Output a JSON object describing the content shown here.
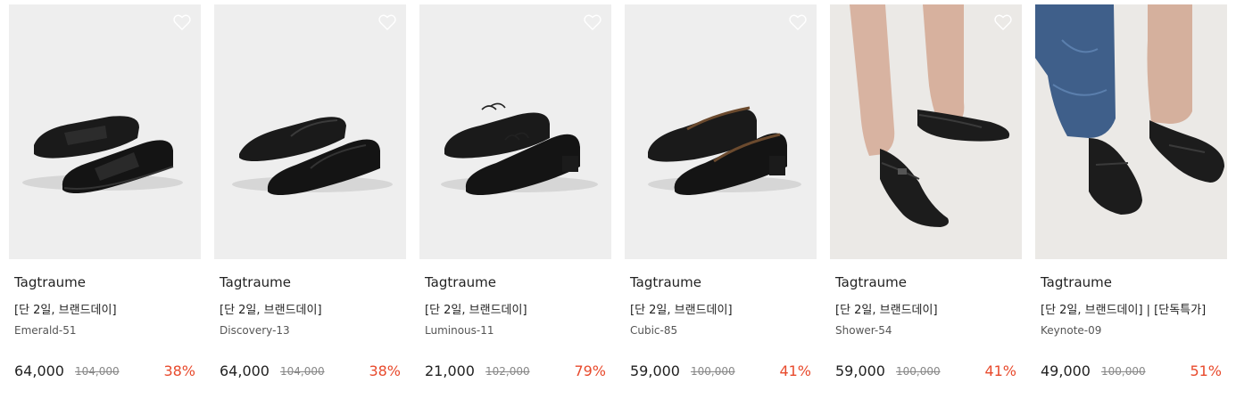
{
  "accent_color": "#e84a2c",
  "products": [
    {
      "brand": "Tagtraume",
      "promo": "[단 2일, 브랜드데이]",
      "model": "Emerald-51",
      "price": "64,000",
      "original_price": "104,000",
      "discount": "38%",
      "image": "black-penny-loafers",
      "heart_icon": "heart-outline-icon"
    },
    {
      "brand": "Tagtraume",
      "promo": "[단 2일, 브랜드데이]",
      "model": "Discovery-13",
      "price": "64,000",
      "original_price": "104,000",
      "discount": "38%",
      "image": "black-slip-on-loafers",
      "heart_icon": "heart-outline-icon"
    },
    {
      "brand": "Tagtraume",
      "promo": "[단 2일, 브랜드데이]",
      "model": "Luminous-11",
      "price": "21,000",
      "original_price": "102,000",
      "discount": "79%",
      "image": "black-lace-up-oxfords",
      "heart_icon": "heart-outline-icon"
    },
    {
      "brand": "Tagtraume",
      "promo": "[단 2일, 브랜드데이]",
      "model": "Cubic-85",
      "price": "59,000",
      "original_price": "100,000",
      "discount": "41%",
      "image": "black-heeled-pumps",
      "heart_icon": "heart-outline-icon"
    },
    {
      "brand": "Tagtraume",
      "promo": "[단 2일, 브랜드데이]",
      "model": "Shower-54",
      "price": "59,000",
      "original_price": "100,000",
      "discount": "41%",
      "image": "black-mary-jane-flats-worn",
      "heart_icon": "heart-outline-icon"
    },
    {
      "brand": "Tagtraume",
      "promo": "[단 2일, 브랜드데이] | [단독특가]",
      "model": "Keynote-09",
      "price": "49,000",
      "original_price": "100,000",
      "discount": "51%",
      "image": "black-loafers-worn-with-jeans",
      "heart_icon": "heart-outline-icon"
    }
  ]
}
